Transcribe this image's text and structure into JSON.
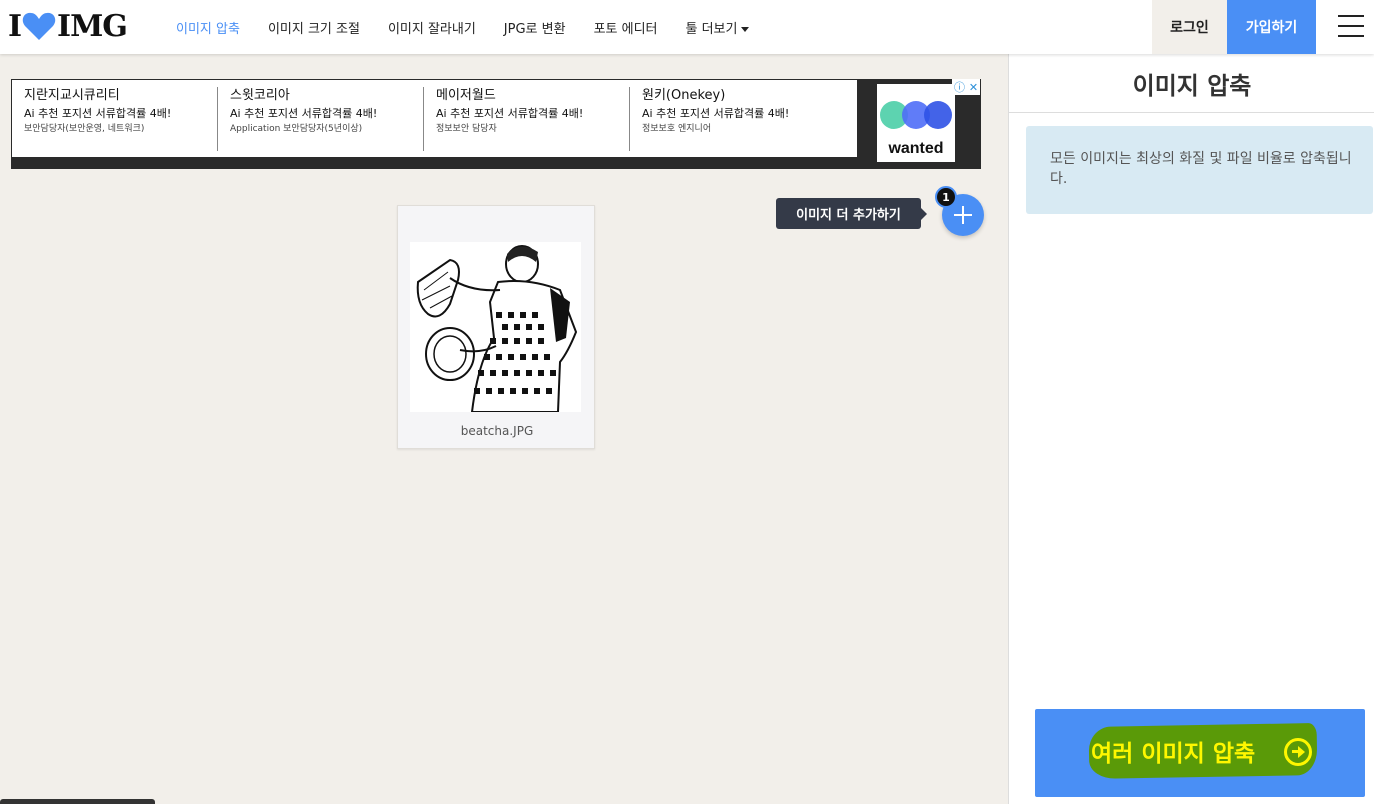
{
  "header": {
    "logo_left": "I",
    "logo_right": "IMG",
    "nav": [
      {
        "label": "이미지 압축",
        "active": true
      },
      {
        "label": "이미지 크기 조절",
        "active": false
      },
      {
        "label": "이미지 잘라내기",
        "active": false
      },
      {
        "label": "JPG로 변환",
        "active": false
      },
      {
        "label": "포토 에디터",
        "active": false
      },
      {
        "label": "툴 더보기",
        "active": false
      }
    ],
    "login_label": "로그인",
    "signup_label": "가입하기"
  },
  "ad": {
    "columns": [
      {
        "company": "지란지교시큐리티",
        "headline": "Ai 추천 포지션 서류합격률 4배!",
        "role": "보안담당자(보안운영, 네트워크)"
      },
      {
        "company": "스윗코리아",
        "headline": "Ai 추천 포지션 서류합격률 4배!",
        "role": "Application 보안담당자(5년이상)"
      },
      {
        "company": "메이저월드",
        "headline": "Ai 추천 포지션 서류합격률 4배!",
        "role": "정보보안 담당자"
      },
      {
        "company": "원키(Onekey)",
        "headline": "Ai 추천 포지션 서류합격률 4배!",
        "role": "정보보호 엔지니어"
      }
    ],
    "brand": "wanted",
    "info_icon": "ⓘ",
    "close_icon": "✕"
  },
  "files": [
    {
      "name": "beatcha.JPG"
    }
  ],
  "add_more": {
    "tooltip": "이미지 더 추가하기",
    "count": "1"
  },
  "sidebar": {
    "title": "이미지 압축",
    "info": "모든 이미지는 최상의 화질 및 파일 비율로 압축됩니다.",
    "action_label": "여러 이미지 압축"
  },
  "colors": {
    "accent": "#4a8ff5",
    "highlight_text": "#fff700",
    "highlight_bg": "#5a9a08"
  }
}
